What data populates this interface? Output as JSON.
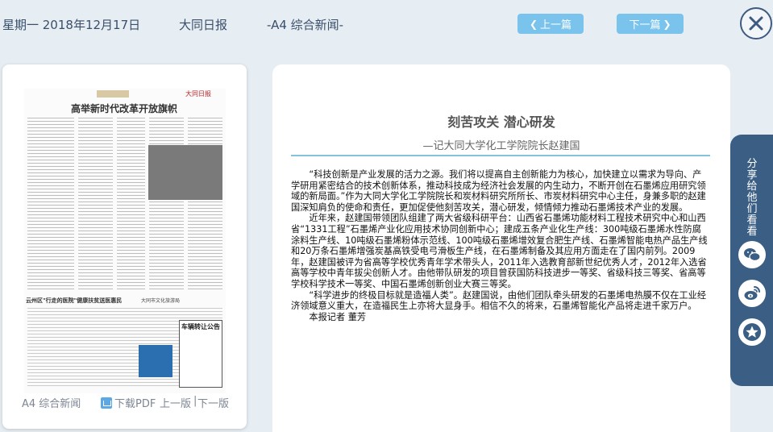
{
  "header": {
    "date": "星期一 2018年12月17日",
    "paper_name": "大同日报",
    "section": "-A4 综合新闻-",
    "prev_label": "上一篇",
    "next_label": "下一篇",
    "close_icon": "close-icon"
  },
  "thumbnail": {
    "headline": "高举新时代改革开放旗帜",
    "logo_text": "大同日报",
    "subhead_left": "云州区\"行走的医院\"健康扶贫送医惠民",
    "subhead_right": "大同市文化旅游局",
    "notice_title": "车辆转让公告",
    "section_label": "A4 综合新闻",
    "pdf_label": "下载PDF",
    "prev_page_label": "上一版",
    "separator": "|",
    "next_page_label": "下一版"
  },
  "article": {
    "title": "刻苦攻关 潜心研发",
    "subtitle": "—记大同大学化工学院院长赵建国",
    "paragraphs": [
      "“科技创新是产业发展的活力之源。我们将以提高自主创新能力为核心，加快建立以需求为导向、产学研用紧密结合的技术创新体系，推动科技成为经济社会发展的内生动力，不断开创在石墨烯应用研究领域的新局面。”作为大同大学化工学院院长和炭材料研究所所长、市炭材料研究中心主任，身兼多职的赵建国深知肩负的使命和责任，更加促使他刻苦攻关，潜心研发，倾情倾力推动石墨烯技术产业的发展。",
      "近年来，赵建国带领团队组建了两大省级科研平台：山西省石墨烯功能材料工程技术研究中心和山西省“1331工程”石墨烯产业化应用技术协同创新中心；建成五条产业化生产线：300吨级石墨烯水性防腐涂料生产线、10吨级石墨烯粉体示范线、100吨级石墨烯增效复合肥生产线、石墨烯智能电热产品生产线和20万条石墨烯增强炭基高铁受电弓滑板生产线，在石墨烯制备及其应用方面走在了国内前列。2009年，赵建国被评为省高等学校优秀青年学术带头人，2011年入选教育部新世纪优秀人才，2012年入选省高等学校中青年拔尖创新人才。由他带队研发的项目曾获国防科技进步一等奖、省级科技三等奖、省高等学校科学技术一等奖、中国石墨烯创新创业大赛三等奖。",
      "“科学进步的终极目标就是造福人类”。赵建国说，由他们团队牵头研发的石墨烯电热膜不仅在工业经济领域意义重大，在造福民生上亦将大显身手。相信不久的将来，石墨烯智能化产品将走进千家万户。",
      "本报记者  董芳"
    ]
  },
  "share": {
    "label": "分享给他们看看",
    "icons": [
      "wechat-icon",
      "weibo-icon",
      "favorite-star-icon"
    ]
  },
  "colors": {
    "page_bg": "#e6eef4",
    "nav_button": "#79c3ec",
    "share_panel": "#3b5f84",
    "divider": "#83c4dc"
  }
}
